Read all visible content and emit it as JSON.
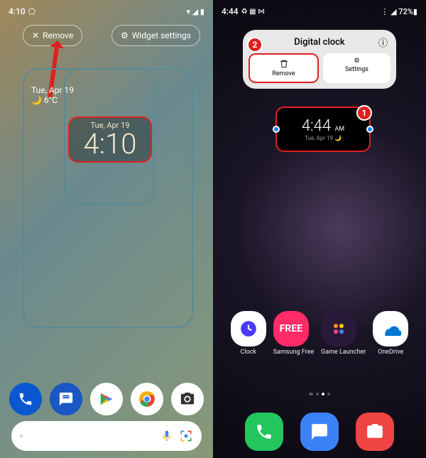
{
  "left": {
    "status": {
      "time": "4:10",
      "icons": "▾ ◢ ▮"
    },
    "remove_label": "Remove",
    "settings_label": "Widget settings",
    "mini_date": "Tue, Apr 19",
    "mini_temp": "6°C",
    "widget": {
      "date": "Tue, Apr 19",
      "time": "4:10"
    },
    "search_placeholder": " "
  },
  "right": {
    "status": {
      "time": "4:44",
      "icons_left": "♻ ▦ ⋈",
      "icons_right": "⋮ ◢ 72%▮"
    },
    "panel": {
      "title": "Digital clock",
      "remove": "Remove",
      "settings": "Settings"
    },
    "widget": {
      "time": "4:44",
      "ampm": "AM",
      "date": "Tue, Apr 19 🌙"
    },
    "apps": [
      {
        "label": "Clock"
      },
      {
        "label": "Samsung Free"
      },
      {
        "label": "Game Launcher"
      },
      {
        "label": "OneDrive"
      }
    ],
    "badges": {
      "one": "1",
      "two": "2"
    }
  }
}
